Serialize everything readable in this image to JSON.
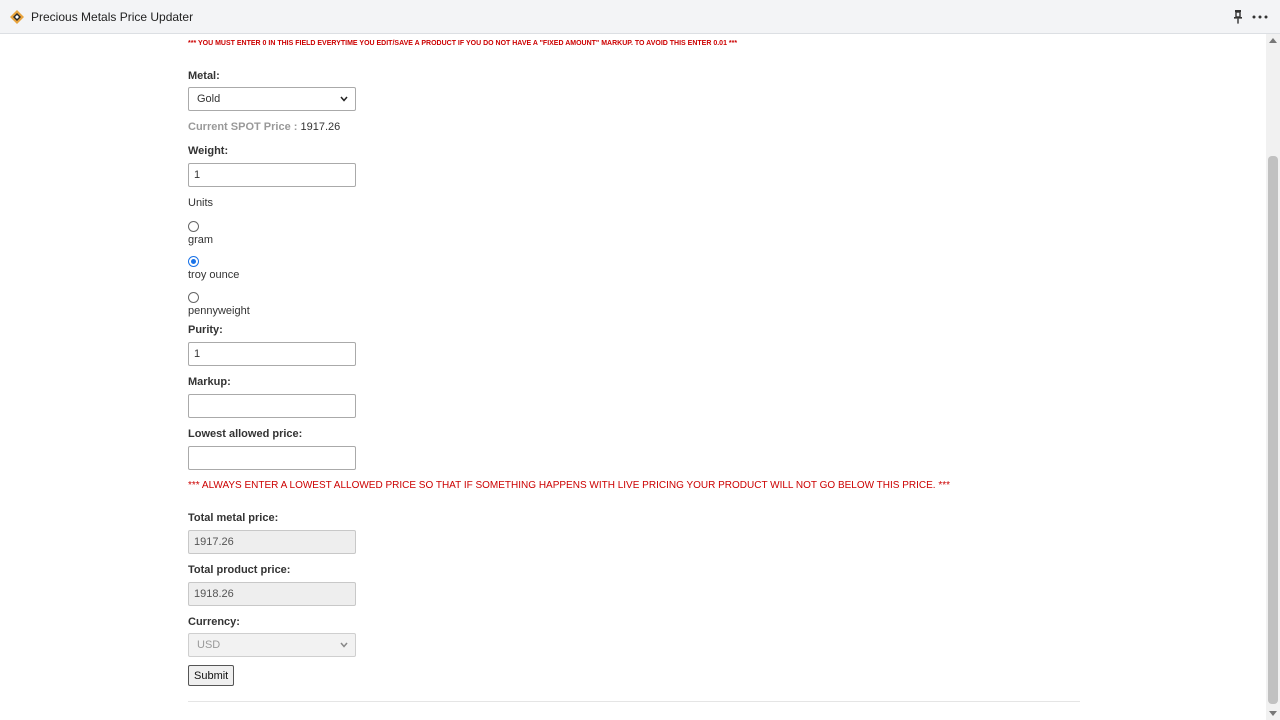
{
  "app": {
    "title": "Precious Metals Price Updater",
    "brand_color": "#e8a33d"
  },
  "notices": {
    "fixed_amount": "*** YOU MUST ENTER 0 IN THIS FIELD EVERYTIME YOU EDIT/SAVE A PRODUCT IF YOU DO NOT HAVE A \"FIXED AMOUNT\" MARKUP. TO AVOID THIS ENTER 0.01 ***",
    "lowest_price": "*** ALWAYS ENTER A LOWEST ALLOWED PRICE SO THAT IF SOMETHING HAPPENS WITH LIVE PRICING YOUR PRODUCT WILL NOT GO BELOW THIS PRICE. ***",
    "color": "#cc0000"
  },
  "form": {
    "metal": {
      "label": "Metal:",
      "value": "Gold"
    },
    "spot": {
      "label": "Current SPOT Price :",
      "value": "1917.26"
    },
    "weight": {
      "label": "Weight:",
      "value": "1"
    },
    "units": {
      "label": "Units",
      "options": [
        {
          "label": "gram",
          "checked": false
        },
        {
          "label": "troy ounce",
          "checked": true
        },
        {
          "label": "pennyweight",
          "checked": false
        }
      ]
    },
    "purity": {
      "label": "Purity:",
      "value": "1"
    },
    "markup": {
      "label": "Markup:",
      "value": ""
    },
    "lowest_allowed": {
      "label": "Lowest allowed price:",
      "value": ""
    },
    "total_metal": {
      "label": "Total metal price:",
      "value": "1917.26"
    },
    "total_product": {
      "label": "Total product price:",
      "value": "1918.26"
    },
    "currency": {
      "label": "Currency:",
      "value": "USD"
    },
    "submit_label": "Submit"
  },
  "icons": {
    "logo": "diamond-logo-icon",
    "pin": "pin-icon",
    "more": "more-options-icon",
    "dropdown": "chevron-down-icon"
  }
}
